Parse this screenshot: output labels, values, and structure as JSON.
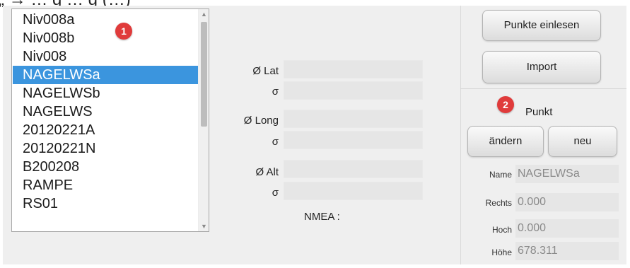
{
  "caption_top_cut": "„ → … g … g (…)",
  "list": {
    "items": [
      "Niv008a",
      "Niv008b",
      "Niv008",
      "NAGELWSa",
      "NAGELWSb",
      "NAGELWS",
      "20120221A",
      "20120221N",
      "B200208",
      "RAMPE",
      "RS01"
    ],
    "selected_index": 3,
    "scroll_up_icon": "chevron-up-icon",
    "scroll_down_icon": "chevron-down-icon"
  },
  "badges": {
    "one": "1",
    "two": "2"
  },
  "fields": {
    "lat_label": "Ø Lat",
    "lat_sigma_label": "σ",
    "long_label": "Ø Long",
    "long_sigma_label": "σ",
    "alt_label": "Ø Alt",
    "alt_sigma_label": "σ",
    "nmea_label": "NMEA :"
  },
  "right": {
    "punkte_einlesen": "Punkte einlesen",
    "import": "Import",
    "punkt_title": "Punkt",
    "aendern": "ändern",
    "neu": "neu",
    "name_label": "Name",
    "name_value": "NAGELWSa",
    "rechts_label": "Rechts",
    "rechts_value": "0.000",
    "hoch_label": "Hoch",
    "hoch_value": "0.000",
    "hoehe_label": "Höhe",
    "hoehe_value": "678.311"
  },
  "colors": {
    "selection": "#3b95de",
    "badge": "#e03b3b",
    "panel": "#efefef"
  }
}
